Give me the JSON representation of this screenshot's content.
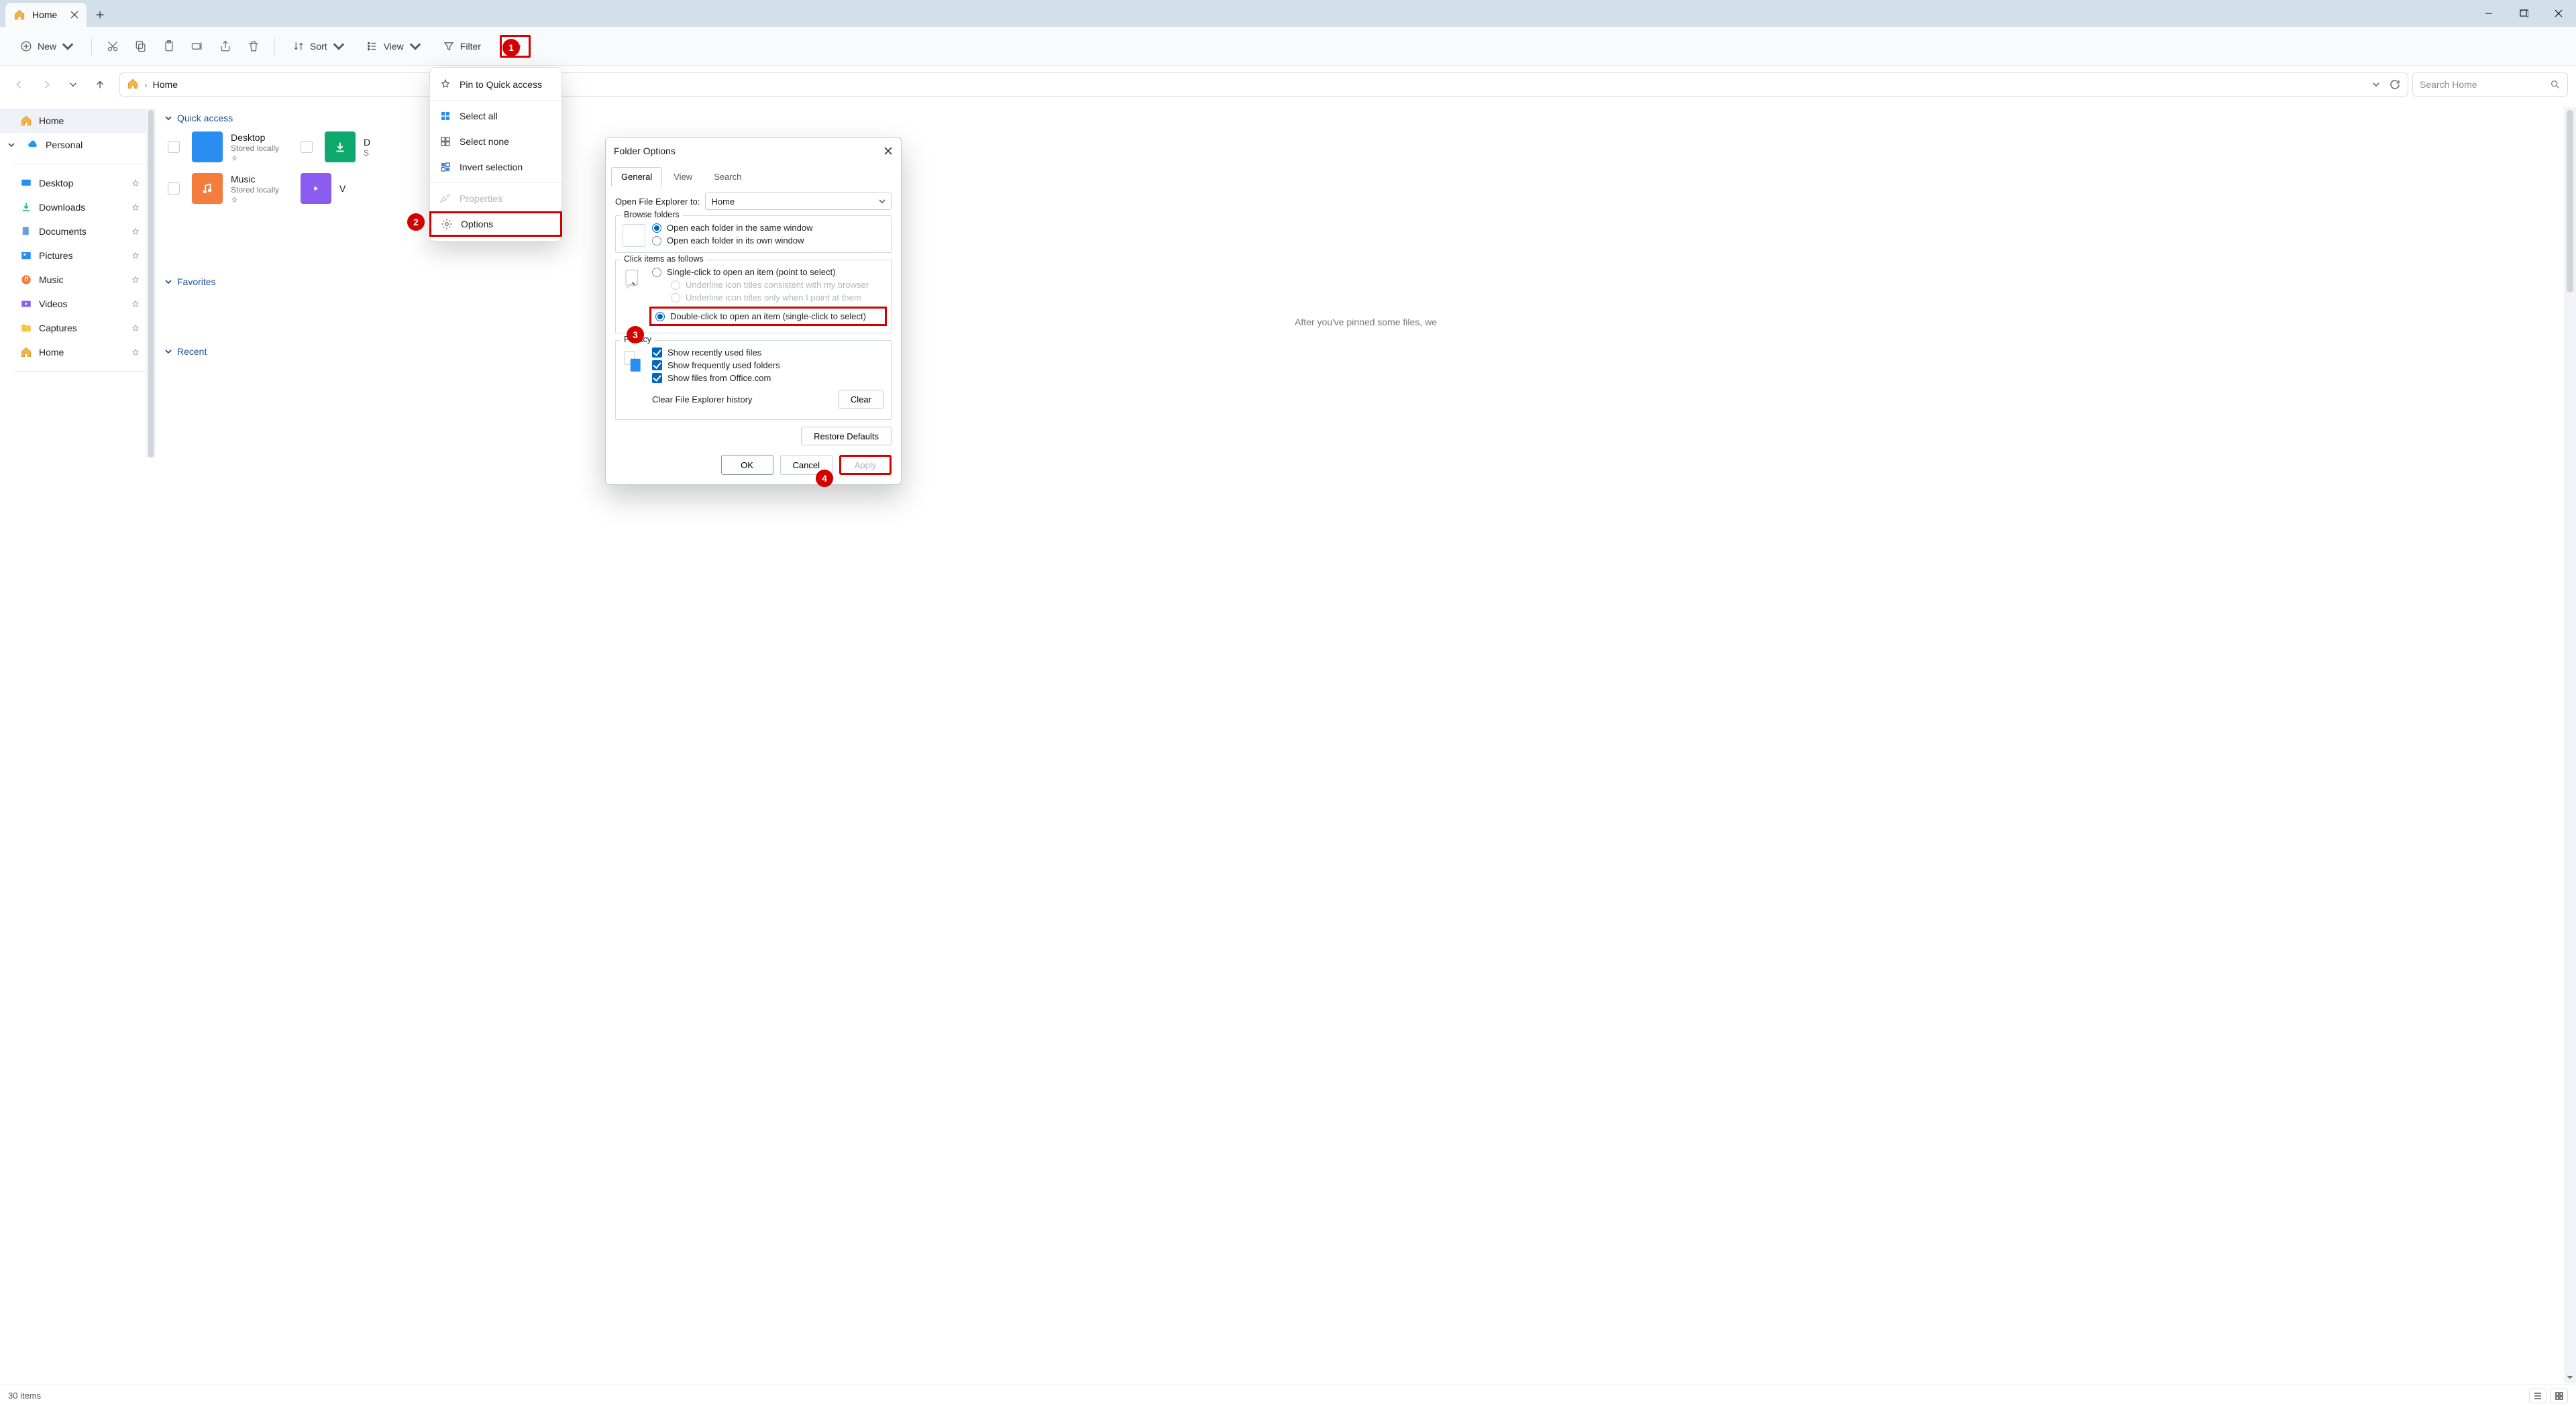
{
  "titlebar": {
    "tab_title": "Home"
  },
  "toolbar": {
    "new": "New",
    "sort": "Sort",
    "view": "View",
    "filter": "Filter"
  },
  "nav": {
    "breadcrumb_root": "Home",
    "search_placeholder": "Search Home"
  },
  "sidebar": {
    "home": "Home",
    "personal": "Personal",
    "pins": [
      "Desktop",
      "Downloads",
      "Documents",
      "Pictures",
      "Music",
      "Videos",
      "Captures",
      "Home"
    ]
  },
  "groups": {
    "quick_access": "Quick access",
    "favorites": "Favorites",
    "recent": "Recent",
    "fav_empty": "After you've pinned some files, we"
  },
  "qa_items": [
    {
      "name": "Desktop",
      "sub": "Stored locally"
    },
    {
      "name": "Music",
      "sub": "Stored locally"
    }
  ],
  "qa_partials": [
    {
      "initial": "D"
    },
    {
      "initial": "S"
    },
    {
      "initial": "V"
    }
  ],
  "ctx": {
    "pin": "Pin to Quick access",
    "sel_all": "Select all",
    "sel_none": "Select none",
    "invert": "Invert selection",
    "props": "Properties",
    "options": "Options"
  },
  "dlg": {
    "title": "Folder Options",
    "tabs": [
      "General",
      "View",
      "Search"
    ],
    "open_lbl": "Open File Explorer to:",
    "open_val": "Home",
    "browse_legend": "Browse folders",
    "browse_a": "Open each folder in the same window",
    "browse_b": "Open each folder in its own window",
    "click_legend": "Click items as follows",
    "click_a": "Single-click to open an item (point to select)",
    "click_a1": "Underline icon titles consistent with my browser",
    "click_a2": "Underline icon titles only when I point at them",
    "click_b": "Double-click to open an item (single-click to select)",
    "priv_legend": "Privacy",
    "priv_a": "Show recently used files",
    "priv_b": "Show frequently used folders",
    "priv_c": "Show files from Office.com",
    "clear_lbl": "Clear File Explorer history",
    "clear_btn": "Clear",
    "restore": "Restore Defaults",
    "ok": "OK",
    "cancel": "Cancel",
    "apply": "Apply"
  },
  "status": {
    "items": "30 items"
  },
  "callouts": {
    "c1": "1",
    "c2": "2",
    "c3": "3",
    "c4": "4"
  }
}
